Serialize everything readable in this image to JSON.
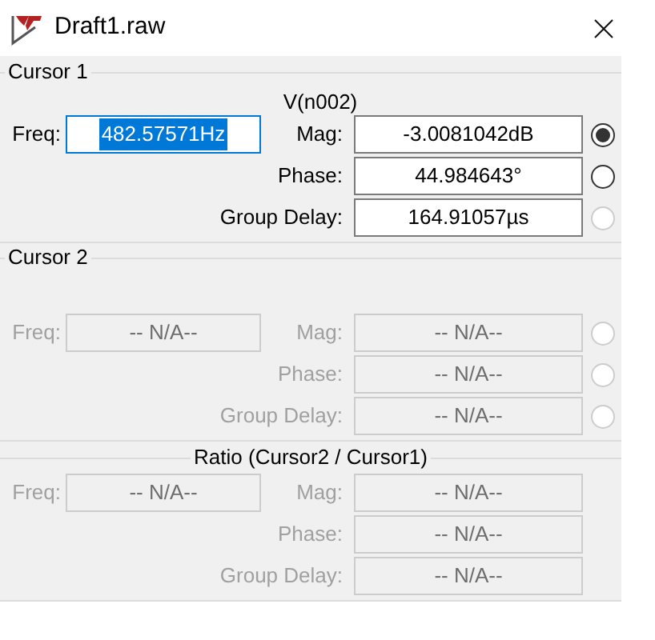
{
  "window": {
    "title": "Draft1.raw"
  },
  "sections": [
    {
      "title": "Cursor 1",
      "kind": "group",
      "trace": "V(n002)",
      "freq": {
        "label": "Freq:",
        "value": "482.57571Hz",
        "disabled": false,
        "focused": true
      },
      "rows": [
        {
          "label": "Mag:",
          "value": "-3.0081042dB",
          "disabled": false,
          "radio": {
            "selected": true,
            "disabled": false
          }
        },
        {
          "label": "Phase:",
          "value": "44.984643°",
          "disabled": false,
          "radio": {
            "selected": false,
            "disabled": false
          }
        },
        {
          "label": "Group Delay:",
          "value": "164.91057µs",
          "disabled": false,
          "radio": {
            "selected": false,
            "disabled": true
          }
        }
      ]
    },
    {
      "title": "Cursor 2",
      "kind": "group",
      "freq": {
        "label": "Freq:",
        "value": "-- N/A--",
        "disabled": true,
        "focused": false
      },
      "rows": [
        {
          "label": "Mag:",
          "value": "-- N/A--",
          "disabled": true,
          "radio": {
            "selected": false,
            "disabled": true
          }
        },
        {
          "label": "Phase:",
          "value": "-- N/A--",
          "disabled": true,
          "radio": {
            "selected": false,
            "disabled": true
          }
        },
        {
          "label": "Group Delay:",
          "value": "-- N/A--",
          "disabled": true,
          "radio": {
            "selected": false,
            "disabled": true
          }
        }
      ]
    },
    {
      "title": "Ratio (Cursor2 / Cursor1)",
      "kind": "centered",
      "freq": {
        "label": "Freq:",
        "value": "-- N/A--",
        "disabled": true,
        "focused": false
      },
      "rows": [
        {
          "label": "Mag:",
          "value": "-- N/A--",
          "disabled": true
        },
        {
          "label": "Phase:",
          "value": "-- N/A--",
          "disabled": true
        },
        {
          "label": "Group Delay:",
          "value": "-- N/A--",
          "disabled": true
        }
      ]
    }
  ]
}
